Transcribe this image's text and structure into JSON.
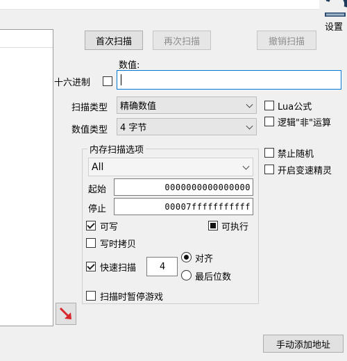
{
  "settings": {
    "label": "设置",
    "icon": "cheat-engine-logo-icon"
  },
  "buttons": {
    "first_scan": "首次扫描",
    "next_scan": "再次扫描",
    "undo_scan": "撤销扫描",
    "add_address": "手动添加地址"
  },
  "value": {
    "label": "数值:",
    "current": ""
  },
  "hex": {
    "label": "十六进制",
    "checked": false
  },
  "scan_type": {
    "label": "扫描类型",
    "selected": "精确数值"
  },
  "value_type": {
    "label": "数值类型",
    "selected": "4 字节"
  },
  "options_right": {
    "lua": "Lua公式",
    "logical_not": "逻辑\"非\"运算",
    "disable_random": "禁止随机",
    "speedhack": "开启变速精灵"
  },
  "memory_options": {
    "title": "内存扫描选项",
    "region": "All",
    "start_label": "起始",
    "start_value": "0000000000000000",
    "stop_label": "停止",
    "stop_value": "00007fffffffffff",
    "writable": {
      "label": "可写",
      "state": "checked"
    },
    "executable": {
      "label": "可执行",
      "state": "indeterminate"
    },
    "copy_on_write": {
      "label": "写时拷贝",
      "state": "unchecked"
    },
    "fast_scan": {
      "label": "快速扫描",
      "state": "checked",
      "value": "4"
    },
    "align": {
      "label": "对齐",
      "selected": true
    },
    "last_digits": {
      "label": "最后位数",
      "selected": false
    },
    "pause_game": {
      "label": "扫描时暂停游戏",
      "state": "unchecked"
    }
  },
  "colors": {
    "arrow": "#d9262c",
    "accent_border": "#0078d7"
  }
}
